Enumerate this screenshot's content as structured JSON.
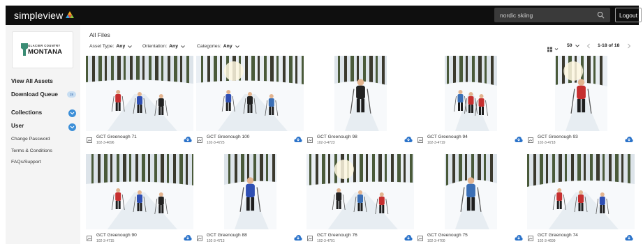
{
  "app": {
    "brand": "simpleview",
    "search_value": "nordic skiing",
    "logout_label": "Logout"
  },
  "logo": {
    "top": "GLACIER COUNTRY",
    "main": "MONTANA"
  },
  "sidebar": {
    "view_all": "View All Assets",
    "download_queue": "Download Queue",
    "download_queue_count": "28",
    "collections": "Collections",
    "user": "User",
    "change_password": "Change Password",
    "terms": "Terms & Conditions",
    "faqs": "FAQs/Support"
  },
  "main": {
    "title": "All Files",
    "filters": [
      {
        "label": "Asset Type:",
        "value": "Any"
      },
      {
        "label": "Orientation:",
        "value": "Any"
      },
      {
        "label": "Categories:",
        "value": "Any"
      }
    ],
    "per_page": "50",
    "pagination": "1-18 of 18"
  },
  "assets": [
    {
      "title": "GCT Greenough 71",
      "id": "102-3-4696",
      "scene": "three skiers in forest",
      "orientation": "landscape"
    },
    {
      "title": "GCT Greenough 100",
      "id": "102-3-4725",
      "scene": "skiers in sunny forest",
      "orientation": "landscape"
    },
    {
      "title": "GCT Greenough 98",
      "id": "102-3-4723",
      "scene": "skier in red jacket",
      "orientation": "portrait"
    },
    {
      "title": "GCT Greenough 94",
      "id": "102-3-4719",
      "scene": "group of skiers",
      "orientation": "portrait"
    },
    {
      "title": "GCT Greenough 93",
      "id": "102-3-4718",
      "scene": "lone skier",
      "orientation": "portrait"
    },
    {
      "title": "GCT Greenough 90",
      "id": "102-3-4715",
      "scene": "skiers in meadow",
      "orientation": "landscape"
    },
    {
      "title": "GCT Greenough 88",
      "id": "102-3-4713",
      "scene": "three skiers",
      "orientation": "portrait"
    },
    {
      "title": "GCT Greenough 76",
      "id": "102-3-4701",
      "scene": "skiers on trail",
      "orientation": "landscape"
    },
    {
      "title": "GCT Greenough 75",
      "id": "102-3-4700",
      "scene": "skier in blue jacket",
      "orientation": "portrait"
    },
    {
      "title": "GCT Greenough 74",
      "id": "102-3-4699",
      "scene": "skiers in sunlight",
      "orientation": "landscape"
    }
  ],
  "colors": {
    "topbar": "#0f0f0f",
    "sidebar": "#f4f4f4",
    "accent": "#3c8fd8",
    "badge_bg": "#c8def2"
  }
}
